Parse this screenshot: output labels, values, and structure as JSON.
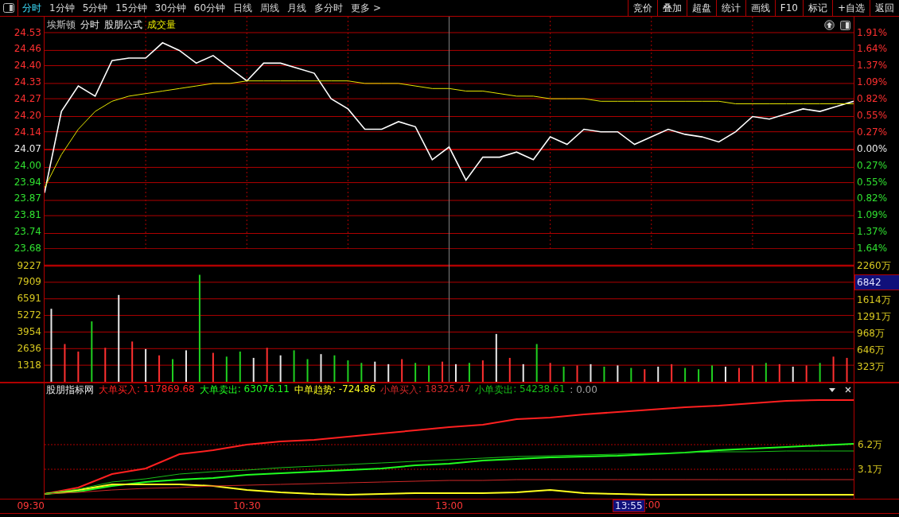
{
  "toolbar": {
    "tabs": [
      {
        "label": "分时",
        "selected": true
      },
      {
        "label": "1分钟",
        "selected": false
      },
      {
        "label": "5分钟",
        "selected": false
      },
      {
        "label": "15分钟",
        "selected": false
      },
      {
        "label": "30分钟",
        "selected": false
      },
      {
        "label": "60分钟",
        "selected": false
      },
      {
        "label": "日线",
        "selected": false
      },
      {
        "label": "周线",
        "selected": false
      },
      {
        "label": "月线",
        "selected": false
      },
      {
        "label": "多分时",
        "selected": false
      },
      {
        "label": "更多 >",
        "selected": false
      }
    ],
    "buttons": [
      "竞价",
      "叠加",
      "超盘",
      "统计",
      "画线",
      "F10",
      "标记",
      "+自选",
      "返回"
    ]
  },
  "price_panel": {
    "header": [
      {
        "text": "埃斯顿",
        "kind": "name"
      },
      {
        "text": "分时",
        "kind": "plain"
      },
      {
        "text": "股朋公式",
        "kind": "plain"
      },
      {
        "text": "成交量",
        "kind": "accent"
      }
    ],
    "right_axis": [
      {
        "text": "1.91%",
        "kind": "up"
      },
      {
        "text": "1.64%",
        "kind": "up"
      },
      {
        "text": "1.37%",
        "kind": "up"
      },
      {
        "text": "1.09%",
        "kind": "up"
      },
      {
        "text": "0.82%",
        "kind": "up"
      },
      {
        "text": "0.55%",
        "kind": "up"
      },
      {
        "text": "0.27%",
        "kind": "up"
      },
      {
        "text": "0.00%",
        "kind": "flat"
      },
      {
        "text": "0.27%",
        "kind": "down"
      },
      {
        "text": "0.55%",
        "kind": "down"
      },
      {
        "text": "0.82%",
        "kind": "down"
      },
      {
        "text": "1.09%",
        "kind": "down"
      },
      {
        "text": "1.37%",
        "kind": "down"
      },
      {
        "text": "1.64%",
        "kind": "down"
      }
    ],
    "chart_data": {
      "type": "line",
      "grid": true,
      "categories": [
        null,
        null,
        null,
        null,
        null,
        null,
        null,
        null,
        null,
        null,
        null,
        null,
        null,
        null,
        null,
        null,
        null,
        null,
        null,
        null,
        null,
        null,
        null,
        null,
        null,
        null,
        null,
        null,
        null,
        null,
        null,
        null,
        null,
        null,
        null,
        null,
        null,
        null,
        null,
        null,
        null,
        null,
        null,
        null,
        null,
        null,
        null,
        null,
        null
      ],
      "ylim": [
        23.68,
        24.53
      ],
      "yticks": [
        {
          "value": 24.53,
          "label": "24.53"
        },
        {
          "value": 24.46,
          "label": "24.46"
        },
        {
          "value": 24.4,
          "label": "24.40"
        },
        {
          "value": 24.33,
          "label": "24.33"
        },
        {
          "value": 24.27,
          "label": "24.27"
        },
        {
          "value": 24.2,
          "label": "24.20"
        },
        {
          "value": 24.14,
          "label": "24.14"
        },
        {
          "value": 24.07,
          "label": "24.07"
        },
        {
          "value": 24.0,
          "label": "24.00"
        },
        {
          "value": 23.94,
          "label": "23.94"
        },
        {
          "value": 23.87,
          "label": "23.87"
        },
        {
          "value": 23.81,
          "label": "23.81"
        },
        {
          "value": 23.74,
          "label": "23.74"
        },
        {
          "value": 23.68,
          "label": "23.68"
        }
      ],
      "ref_lines": [
        {
          "axis": "y",
          "value": 24.07
        }
      ],
      "series": [
        {
          "color": "#ffffff",
          "values": [
            23.9,
            24.22,
            24.32,
            24.28,
            24.42,
            24.43,
            24.43,
            24.49,
            24.46,
            24.41,
            24.44,
            24.39,
            24.34,
            24.41,
            24.41,
            24.39,
            24.37,
            24.27,
            24.23,
            24.15,
            24.15,
            24.18,
            24.16,
            24.03,
            24.08,
            23.95,
            24.04,
            24.04,
            24.06,
            24.03,
            24.12,
            24.09,
            24.15,
            24.14,
            24.14,
            24.09,
            24.12,
            24.15,
            24.13,
            24.12,
            24.1,
            24.14,
            24.2,
            24.19,
            24.21,
            24.23,
            24.22,
            24.24,
            24.26
          ]
        },
        {
          "color": "#e6e600",
          "values": [
            23.92,
            24.05,
            24.15,
            24.22,
            24.26,
            24.28,
            24.29,
            24.3,
            24.31,
            24.32,
            24.33,
            24.33,
            24.34,
            24.34,
            24.34,
            24.34,
            24.34,
            24.34,
            24.34,
            24.33,
            24.33,
            24.33,
            24.32,
            24.31,
            24.31,
            24.3,
            24.3,
            24.29,
            24.28,
            24.28,
            24.27,
            24.27,
            24.27,
            24.26,
            24.26,
            24.26,
            24.26,
            24.26,
            24.26,
            24.26,
            24.26,
            24.25,
            24.25,
            24.25,
            24.25,
            24.25,
            24.25,
            24.25,
            24.25
          ]
        }
      ]
    }
  },
  "volume_panel": {
    "right_axis": [
      {
        "text": "2260万",
        "kind": "tick"
      },
      {
        "text": "6842",
        "kind": "cursor"
      },
      {
        "text": "1614万",
        "kind": "tick"
      },
      {
        "text": "1291万",
        "kind": "tick"
      },
      {
        "text": "968万",
        "kind": "tick"
      },
      {
        "text": "646万",
        "kind": "tick"
      },
      {
        "text": "323万",
        "kind": "tick"
      }
    ],
    "chart_data": {
      "type": "bar",
      "grid": true,
      "categories": [
        null,
        null,
        null,
        null,
        null,
        null,
        null,
        null,
        null,
        null,
        null,
        null,
        null,
        null,
        null,
        null,
        null,
        null,
        null,
        null,
        null,
        null,
        null,
        null,
        null,
        null,
        null,
        null,
        null,
        null,
        null,
        null,
        null,
        null,
        null,
        null,
        null,
        null,
        null,
        null,
        null,
        null,
        null,
        null,
        null,
        null,
        null,
        null,
        null,
        null,
        null,
        null,
        null,
        null,
        null,
        null,
        null,
        null,
        null,
        null
      ],
      "ylim": [
        0,
        9227
      ],
      "yticks": [
        {
          "value": 9227,
          "label": "9227"
        },
        {
          "value": 7909,
          "label": "7909"
        },
        {
          "value": 6591,
          "label": "6591"
        },
        {
          "value": 5272,
          "label": "5272"
        },
        {
          "value": 3954,
          "label": "3954"
        },
        {
          "value": 2636,
          "label": "2636"
        },
        {
          "value": 1318,
          "label": "1318"
        }
      ],
      "values": [
        5800,
        3000,
        2400,
        4800,
        2700,
        6900,
        3200,
        2600,
        2100,
        1800,
        2500,
        8500,
        2300,
        2000,
        2400,
        1900,
        2700,
        2100,
        2500,
        1800,
        2200,
        2100,
        1700,
        1500,
        1600,
        1400,
        1800,
        1500,
        1300,
        1600,
        1400,
        1500,
        1700,
        3800,
        1900,
        1400,
        3000,
        1500,
        1200,
        1300,
        1400,
        1200,
        1300,
        1100,
        1000,
        1200,
        1400,
        1100,
        1000,
        1300,
        1200,
        1100,
        1300,
        1500,
        1400,
        1200,
        1300,
        1500,
        2000,
        1900
      ]
    }
  },
  "indicator_panel": {
    "title": "股朋指标网",
    "legend_values": [
      ": 117869.68",
      ": 63076.11",
      ": -724.86",
      ": 18325.47",
      ": 54238.61"
    ],
    "extra_value": ": 0.00",
    "chart_data": {
      "type": "line",
      "grid": true,
      "categories": [
        null,
        null,
        null,
        null,
        null,
        null,
        null,
        null,
        null,
        null,
        null,
        null,
        null,
        null,
        null,
        null,
        null,
        null,
        null,
        null,
        null,
        null,
        null,
        null,
        null
      ],
      "ylim": [
        -0.6,
        13.9
      ],
      "yticks": [
        {
          "value": 6.2,
          "label": "6.2万"
        },
        {
          "value": 3.1,
          "label": "3.1万"
        }
      ],
      "series": [
        {
          "name": "大单买入",
          "color": "#ff2020",
          "values": [
            0,
            0.8,
            2.5,
            3.2,
            5.0,
            5.5,
            6.2,
            6.6,
            6.8,
            7.2,
            7.6,
            8.0,
            8.4,
            8.7,
            9.4,
            9.6,
            10.0,
            10.3,
            10.6,
            10.9,
            11.1,
            11.4,
            11.7,
            11.8,
            11.8
          ]
        },
        {
          "name": "大单卖出",
          "color": "#20ff20",
          "values": [
            0,
            0.3,
            1.0,
            1.5,
            1.8,
            2.0,
            2.4,
            2.6,
            2.8,
            3.0,
            3.2,
            3.6,
            3.8,
            4.2,
            4.4,
            4.6,
            4.7,
            4.8,
            5.0,
            5.2,
            5.5,
            5.7,
            5.9,
            6.1,
            6.3
          ]
        },
        {
          "name": "中单趋势",
          "color": "#ffff20",
          "values": [
            0,
            0.5,
            1.2,
            1.2,
            1.2,
            1.0,
            0.5,
            0.2,
            0.0,
            -0.1,
            0.0,
            0.1,
            0.1,
            0.1,
            0.2,
            0.5,
            0.1,
            0.0,
            -0.1,
            -0.1,
            -0.1,
            -0.1,
            -0.1,
            -0.1,
            -0.1
          ]
        },
        {
          "name": "小单买入",
          "color": "#d02828",
          "values": [
            0,
            0.2,
            0.5,
            0.7,
            0.8,
            1.0,
            1.1,
            1.2,
            1.3,
            1.4,
            1.5,
            1.6,
            1.7,
            1.7,
            1.8,
            1.8,
            1.8,
            1.8,
            1.8,
            1.8,
            1.8,
            1.8,
            1.8,
            1.8,
            1.8
          ]
        },
        {
          "name": "小单卖出",
          "color": "#18c018",
          "values": [
            0,
            0.6,
            1.5,
            1.9,
            2.5,
            2.8,
            3.0,
            3.3,
            3.5,
            3.7,
            3.9,
            4.1,
            4.3,
            4.5,
            4.7,
            4.8,
            4.9,
            5.0,
            5.1,
            5.2,
            5.3,
            5.3,
            5.4,
            5.4,
            5.4
          ]
        }
      ]
    }
  },
  "time_axis": {
    "ticks": [
      "09:30",
      "10:30",
      "13:00"
    ],
    "cursor": "13:55",
    "partial_tick": ":00"
  }
}
